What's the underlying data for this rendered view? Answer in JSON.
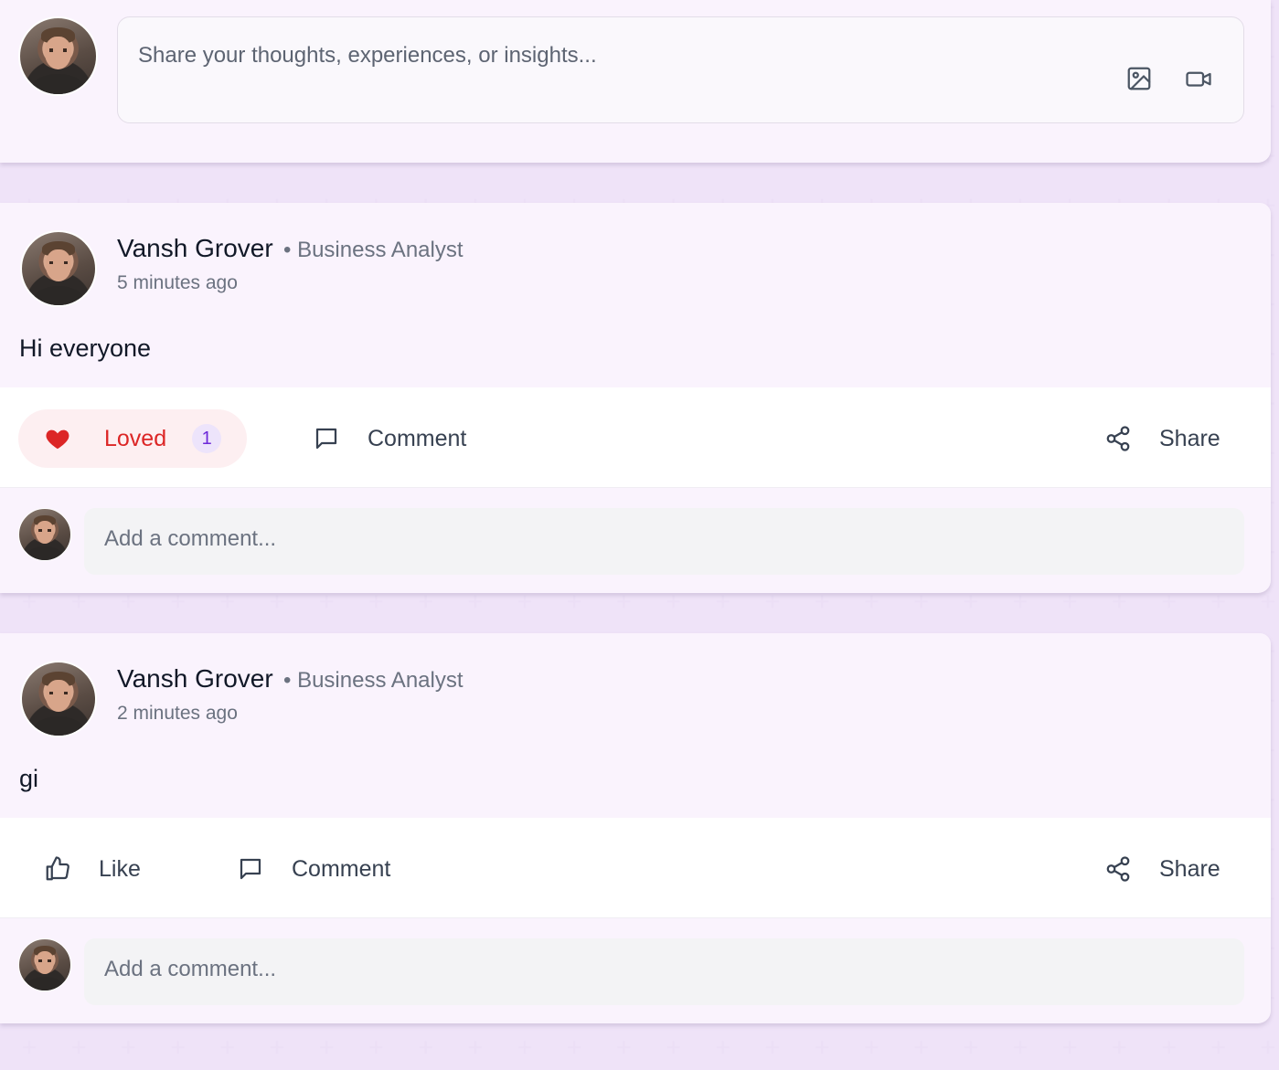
{
  "composer": {
    "placeholder": "Share your thoughts, experiences, or insights...",
    "icons": [
      "image-icon",
      "video-icon"
    ]
  },
  "posts": [
    {
      "author": "Vansh Grover",
      "separator": "•",
      "role": "Business Analyst",
      "time": "5 minutes ago",
      "body": "Hi everyone",
      "reaction": {
        "label": "Loved",
        "count": "1",
        "active": true
      },
      "comment_label": "Comment",
      "share_label": "Share",
      "comment_placeholder": "Add a comment..."
    },
    {
      "author": "Vansh Grover",
      "separator": "•",
      "role": "Business Analyst",
      "time": "2 minutes ago",
      "body": "gi",
      "reaction": {
        "label": "Like",
        "active": false
      },
      "comment_label": "Comment",
      "share_label": "Share",
      "comment_placeholder": "Add a comment..."
    }
  ],
  "colors": {
    "background": "#fbf6fd",
    "loved_text": "#dc2626",
    "loved_bg": "#fdeff1",
    "count_text": "#6d28d9",
    "count_bg": "#ede4fb"
  }
}
